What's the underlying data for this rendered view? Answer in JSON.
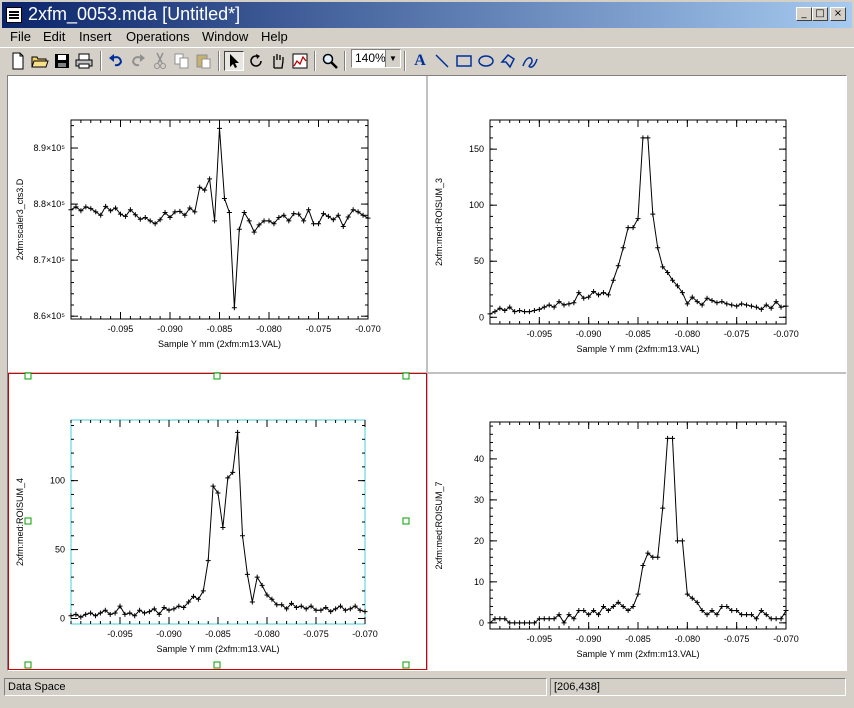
{
  "window": {
    "title": "2xfm_0053.mda [Untitled*]"
  },
  "title_buttons": {
    "minimize": "_",
    "maximize": "□",
    "close": "×"
  },
  "menu": [
    "File",
    "Edit",
    "Insert",
    "Operations",
    "Window",
    "Help"
  ],
  "toolbar": {
    "icons": [
      "new-file-icon",
      "open-folder-icon",
      "save-icon",
      "print-icon",
      "undo-icon",
      "redo-icon",
      "cut-icon",
      "copy-icon",
      "paste-icon",
      "select-arrow-icon",
      "rotate-icon",
      "pan-hand-icon",
      "data-range-icon",
      "zoom-magnifier-icon",
      "text-tool-icon",
      "line-tool-icon",
      "rectangle-tool-icon",
      "ellipse-tool-icon",
      "polygon-tool-icon",
      "freehand-tool-icon"
    ],
    "text_tool": "A",
    "zoom": "140%"
  },
  "status": {
    "left": "Data Space",
    "right": "[206,438]"
  },
  "chart_data": [
    {
      "type": "line",
      "ylabel": "2xfm:scaler3_cts3.D",
      "xlabel": "Sample Y mm (2xfm:m13.VAL)",
      "xlim": [
        -0.1,
        -0.07
      ],
      "ylim": [
        859500,
        895000
      ],
      "xticks": [
        -0.095,
        -0.09,
        -0.085,
        -0.08,
        -0.075,
        -0.07
      ],
      "xtick_labels": [
        "-0.095",
        "-0.090",
        "-0.085",
        "-0.080",
        "-0.075",
        "-0.070"
      ],
      "yticks": [
        860000,
        870000,
        880000,
        890000
      ],
      "ytick_labels": [
        "8.6×10⁵",
        "8.7×10⁵",
        "8.8×10⁵",
        "8.9×10⁵"
      ],
      "x": [
        -0.1,
        -0.0995,
        -0.099,
        -0.0985,
        -0.098,
        -0.0975,
        -0.097,
        -0.0965,
        -0.096,
        -0.0955,
        -0.095,
        -0.0945,
        -0.094,
        -0.0935,
        -0.093,
        -0.0925,
        -0.092,
        -0.0915,
        -0.091,
        -0.0905,
        -0.09,
        -0.0895,
        -0.089,
        -0.0885,
        -0.088,
        -0.0875,
        -0.087,
        -0.0865,
        -0.086,
        -0.0855,
        -0.085,
        -0.0845,
        -0.084,
        -0.0835,
        -0.083,
        -0.0825,
        -0.082,
        -0.0815,
        -0.081,
        -0.0805,
        -0.08,
        -0.0795,
        -0.079,
        -0.0785,
        -0.078,
        -0.0775,
        -0.077,
        -0.0765,
        -0.076,
        -0.0755,
        -0.075,
        -0.0745,
        -0.074,
        -0.0735,
        -0.073,
        -0.0725,
        -0.072,
        -0.0715,
        -0.071,
        -0.0705,
        -0.07
      ],
      "y": [
        879000,
        879500,
        878800,
        879500,
        879200,
        878600,
        878000,
        879600,
        878800,
        879300,
        878200,
        877800,
        879000,
        878100,
        877300,
        877600,
        877000,
        876500,
        877200,
        878500,
        877600,
        878600,
        878700,
        878000,
        879300,
        878600,
        883000,
        882500,
        884500,
        877000,
        893500,
        881000,
        878500,
        861500,
        875500,
        878500,
        877000,
        875000,
        876300,
        877000,
        877000,
        876500,
        877600,
        878000,
        877000,
        878300,
        878200,
        877000,
        879000,
        876500,
        876500,
        878300,
        877800,
        877200,
        878000,
        876000,
        877700,
        879000,
        878600,
        878000,
        877500
      ]
    },
    {
      "type": "line",
      "ylabel": "2xfm:med:ROISUM_3",
      "xlabel": "Sample Y mm (2xfm:m13.VAL)",
      "xlim": [
        -0.1,
        -0.07
      ],
      "ylim": [
        -6,
        176
      ],
      "xticks": [
        -0.095,
        -0.09,
        -0.085,
        -0.08,
        -0.075,
        -0.07
      ],
      "xtick_labels": [
        "-0.095",
        "-0.090",
        "-0.085",
        "-0.080",
        "-0.075",
        "-0.070"
      ],
      "yticks": [
        0,
        50,
        100,
        150
      ],
      "ytick_labels": [
        "0",
        "50",
        "100",
        "150"
      ],
      "x": [
        -0.1,
        -0.0995,
        -0.099,
        -0.0985,
        -0.098,
        -0.0975,
        -0.097,
        -0.0965,
        -0.096,
        -0.0955,
        -0.095,
        -0.0945,
        -0.094,
        -0.0935,
        -0.093,
        -0.0925,
        -0.092,
        -0.0915,
        -0.091,
        -0.0905,
        -0.09,
        -0.0895,
        -0.089,
        -0.0885,
        -0.088,
        -0.0875,
        -0.087,
        -0.0865,
        -0.086,
        -0.0855,
        -0.085,
        -0.0845,
        -0.084,
        -0.0835,
        -0.083,
        -0.0825,
        -0.082,
        -0.0815,
        -0.081,
        -0.0805,
        -0.08,
        -0.0795,
        -0.079,
        -0.0785,
        -0.078,
        -0.0775,
        -0.077,
        -0.0765,
        -0.076,
        -0.0755,
        -0.075,
        -0.0745,
        -0.074,
        -0.0735,
        -0.073,
        -0.0725,
        -0.072,
        -0.0715,
        -0.071,
        -0.0705,
        -0.07
      ],
      "y": [
        3,
        5,
        8,
        6,
        9,
        5,
        6,
        5,
        5,
        6,
        7,
        9,
        11,
        9,
        14,
        11,
        12,
        13,
        22,
        17,
        18,
        23,
        20,
        22,
        20,
        33,
        46,
        62,
        80,
        80,
        88,
        160,
        160,
        92,
        62,
        45,
        40,
        33,
        28,
        22,
        12,
        18,
        14,
        11,
        17,
        15,
        13,
        14,
        12,
        11,
        10,
        12,
        11,
        10,
        9,
        7,
        11,
        8,
        14,
        9,
        10
      ]
    },
    {
      "type": "line",
      "ylabel": "2xfm:med:ROISUM_4",
      "xlabel": "Sample Y mm (2xfm:m13.VAL)",
      "xlim": [
        -0.1,
        -0.07
      ],
      "ylim": [
        -4,
        144
      ],
      "xticks": [
        -0.095,
        -0.09,
        -0.085,
        -0.08,
        -0.075,
        -0.07
      ],
      "xtick_labels": [
        "-0.095",
        "-0.090",
        "-0.085",
        "-0.080",
        "-0.075",
        "-0.070"
      ],
      "yticks": [
        0,
        50,
        100
      ],
      "ytick_labels": [
        "0",
        "50",
        "100"
      ],
      "x": [
        -0.1,
        -0.0995,
        -0.099,
        -0.0985,
        -0.098,
        -0.0975,
        -0.097,
        -0.0965,
        -0.096,
        -0.0955,
        -0.095,
        -0.0945,
        -0.094,
        -0.0935,
        -0.093,
        -0.0925,
        -0.092,
        -0.0915,
        -0.091,
        -0.0905,
        -0.09,
        -0.0895,
        -0.089,
        -0.0885,
        -0.088,
        -0.0875,
        -0.087,
        -0.0865,
        -0.086,
        -0.0855,
        -0.085,
        -0.0845,
        -0.084,
        -0.0835,
        -0.083,
        -0.0825,
        -0.082,
        -0.0815,
        -0.081,
        -0.0805,
        -0.08,
        -0.0795,
        -0.079,
        -0.0785,
        -0.078,
        -0.0775,
        -0.077,
        -0.0765,
        -0.076,
        -0.0755,
        -0.075,
        -0.0745,
        -0.074,
        -0.0735,
        -0.073,
        -0.0725,
        -0.072,
        -0.0715,
        -0.071,
        -0.0705,
        -0.07
      ],
      "y": [
        2,
        3,
        1,
        3,
        4,
        2,
        4,
        6,
        3,
        4,
        9,
        3,
        4,
        2,
        6,
        4,
        5,
        7,
        3,
        8,
        6,
        7,
        9,
        8,
        12,
        16,
        14,
        20,
        42,
        96,
        91,
        66,
        102,
        106,
        135,
        60,
        32,
        12,
        30,
        24,
        17,
        14,
        10,
        10,
        7,
        11,
        8,
        9,
        7,
        9,
        6,
        6,
        8,
        5,
        7,
        9,
        6,
        7,
        9,
        6,
        5
      ]
    },
    {
      "type": "line",
      "ylabel": "2xfm:med:ROISUM_7",
      "xlabel": "Sample Y mm (2xfm:m13.VAL)",
      "xlim": [
        -0.1,
        -0.07
      ],
      "ylim": [
        -1.5,
        49
      ],
      "xticks": [
        -0.095,
        -0.09,
        -0.085,
        -0.08,
        -0.075,
        -0.07
      ],
      "xtick_labels": [
        "-0.095",
        "-0.090",
        "-0.085",
        "-0.080",
        "-0.075",
        "-0.070"
      ],
      "yticks": [
        0,
        10,
        20,
        30,
        40
      ],
      "ytick_labels": [
        "0",
        "10",
        "20",
        "30",
        "40"
      ],
      "x": [
        -0.1,
        -0.0995,
        -0.099,
        -0.0985,
        -0.098,
        -0.0975,
        -0.097,
        -0.0965,
        -0.096,
        -0.0955,
        -0.095,
        -0.0945,
        -0.094,
        -0.0935,
        -0.093,
        -0.0925,
        -0.092,
        -0.0915,
        -0.091,
        -0.0905,
        -0.09,
        -0.0895,
        -0.089,
        -0.0885,
        -0.088,
        -0.0875,
        -0.087,
        -0.0865,
        -0.086,
        -0.0855,
        -0.085,
        -0.0845,
        -0.084,
        -0.0835,
        -0.083,
        -0.0825,
        -0.082,
        -0.0815,
        -0.081,
        -0.0805,
        -0.08,
        -0.0795,
        -0.079,
        -0.0785,
        -0.078,
        -0.0775,
        -0.077,
        -0.0765,
        -0.076,
        -0.0755,
        -0.075,
        -0.0745,
        -0.074,
        -0.0735,
        -0.073,
        -0.0725,
        -0.072,
        -0.0715,
        -0.071,
        -0.0705,
        -0.07
      ],
      "y": [
        0,
        1,
        1,
        1,
        0,
        0,
        0,
        0,
        0,
        0,
        1,
        1,
        1,
        1,
        2,
        0,
        2,
        1,
        3,
        3,
        2,
        3,
        2,
        4,
        3,
        4,
        5,
        4,
        3,
        4,
        7,
        14,
        17,
        16,
        16,
        28,
        45,
        45,
        20,
        20,
        7,
        6,
        5,
        3,
        2,
        3,
        2,
        4,
        4,
        3,
        3,
        2,
        2,
        2,
        1,
        3,
        2,
        1,
        1,
        1,
        3
      ]
    }
  ]
}
